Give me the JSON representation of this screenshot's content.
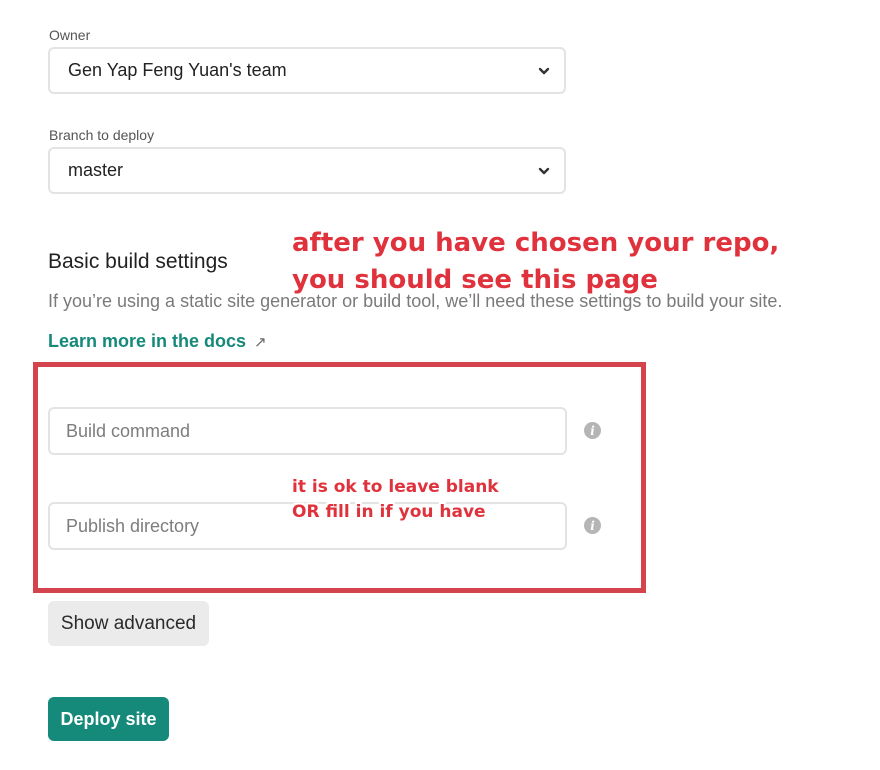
{
  "owner": {
    "label": "Owner",
    "value": "Gen Yap Feng Yuan's team"
  },
  "branch": {
    "label": "Branch to deploy",
    "value": "master"
  },
  "build_settings": {
    "title": "Basic build settings",
    "description": "If you’re using a static site generator or build tool, we’ll need these settings to build your site.",
    "docs_link": "Learn more in the docs",
    "docs_icon": "external-link-arrow",
    "build_command": {
      "placeholder": "Build command",
      "value": ""
    },
    "publish_directory": {
      "placeholder": "Publish directory",
      "value": ""
    },
    "info_icon": "info-icon"
  },
  "buttons": {
    "show_advanced": "Show advanced",
    "deploy": "Deploy site"
  },
  "annotations": {
    "main_line1": "after you have chosen your repo,",
    "main_line2": "you should see this page",
    "small_line1": "it is ok to leave blank",
    "small_line2": "OR fill in if you have"
  },
  "colors": {
    "accent": "#15897a",
    "annotation": "#e0323c",
    "highlight_box": "#d5434d"
  }
}
